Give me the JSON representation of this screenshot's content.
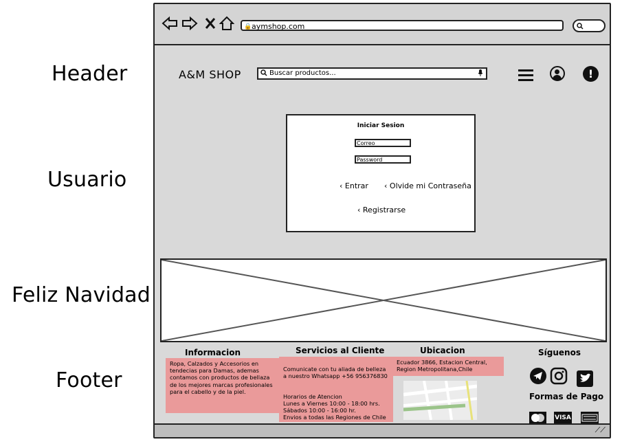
{
  "side_labels": {
    "header": "Header",
    "usuario": "Usuario",
    "feliz_navidad": "Feliz Navidad",
    "footer": "Footer"
  },
  "browser": {
    "url": "aymshop.com",
    "nav_icons": [
      "back-arrow-icon",
      "forward-arrow-icon",
      "close-icon",
      "home-icon"
    ]
  },
  "header": {
    "logo": "A&M SHOP",
    "search_placeholder": "Buscar productos..."
  },
  "login": {
    "title": "Iniciar Sesion",
    "email_placeholder": "Correo",
    "password_placeholder": "Password",
    "enter_label": "Entrar",
    "forgot_label": "Olvide mi Contraseña",
    "register_label": "Registrarse"
  },
  "footer": {
    "info_title": "Informacion",
    "info_text": "Ropa, Calzados y Accesorios en\ntendecias para Damas, ademas\ncontamos con productos de bellaza\nde los mejores marcas profesionales\npara el cabello y de la piel.",
    "service_title": "Servicios al Cliente",
    "service_contact": "Comunicate con tu aliada de belleza\na nuestro Whatsapp +56 956376830",
    "service_hours": "Horarios de Atencion\nLunes a Viernes 10:00 - 18:00 hrs.\nSábados 10:00 - 16:00 hr.\nEnvios a todas las Regiones de Chile",
    "location_title": "Ubicacion",
    "location_text": "Ecuador 3866, Estacion Central,\nRegion Metropolitana,Chile",
    "social_title": "Síguenos",
    "payment_title": "Formas de Pago",
    "payment_visa": "VISA"
  },
  "colors": {
    "pink": "#ea9a9a",
    "background": "#d9d9d9"
  }
}
